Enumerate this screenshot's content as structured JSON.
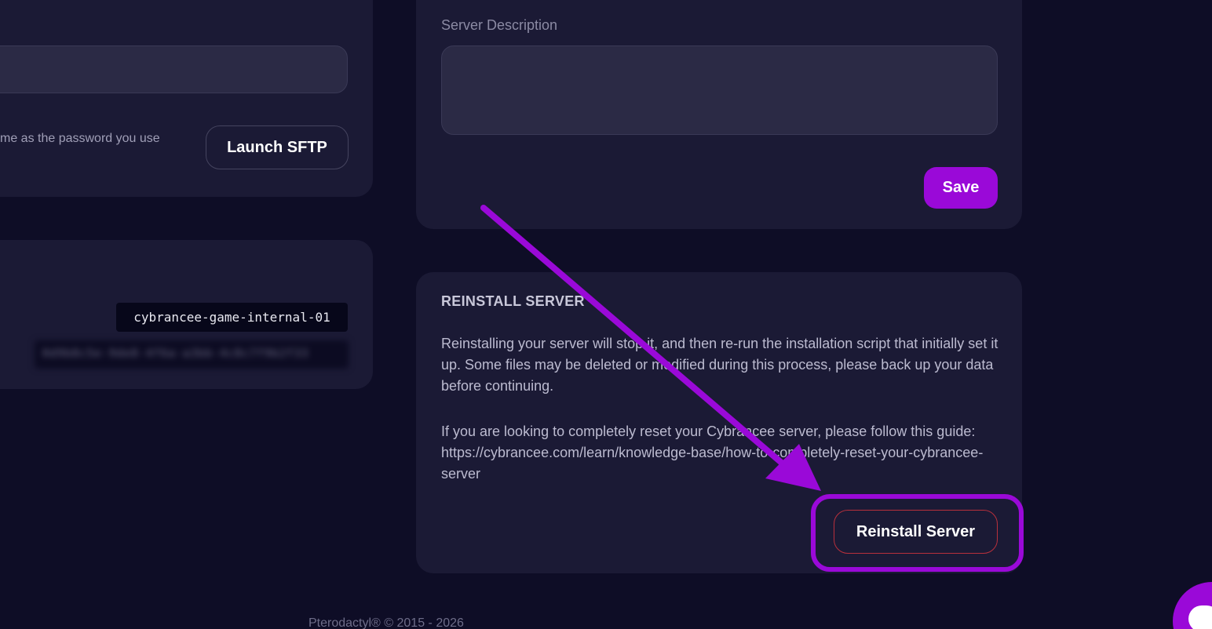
{
  "sftp": {
    "note": "me as the password you use",
    "launch_label": "Launch SFTP"
  },
  "debug": {
    "node_name": "cybrancee-game-internal-01",
    "server_uuid_blurred": "0d9b8c5e-9de8-4f6a-a3bb-4c8c7f9b2f33"
  },
  "description": {
    "label": "Server Description",
    "value": "",
    "save_label": "Save"
  },
  "reinstall": {
    "title": "REINSTALL SERVER",
    "paragraph1": "Reinstalling your server will stop it, and then re-run the installation script that initially set it up. Some files may be deleted or modified during this process, please back up your data before continuing.",
    "paragraph2": "If you are looking to completely reset your Cybrancee server, please follow this guide: https://cybrancee.com/learn/knowledge-base/how-to-completely-reset-your-cybrancee-server",
    "button_label": "Reinstall Server"
  },
  "footer": {
    "text": "Pterodactyl® © 2015 - 2026"
  },
  "chat": {
    "icon": "chat-icon"
  },
  "colors": {
    "background": "#0e0d26",
    "card": "#1b1a35",
    "accent": "#9a09d8",
    "danger_border": "#b8303c"
  }
}
